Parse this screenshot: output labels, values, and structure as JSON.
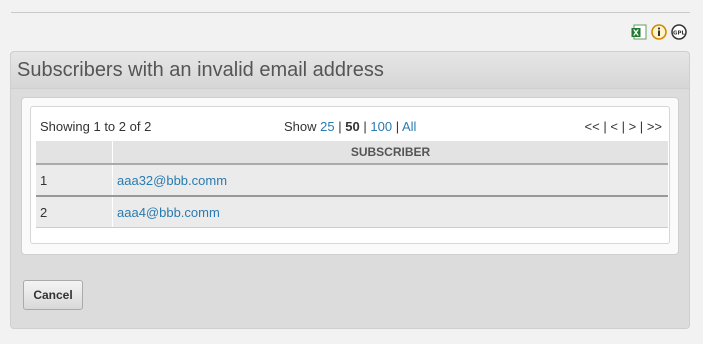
{
  "icons": [
    "excel-export-icon",
    "info-icon",
    "gpl-icon"
  ],
  "panel": {
    "title": "Subscribers with an invalid email address"
  },
  "pager": {
    "summary": "Showing 1 to 2 of 2",
    "show_label": "Show",
    "sizes": [
      "25",
      "50",
      "100",
      "All"
    ],
    "current_size": "50",
    "nav": [
      "<<",
      "<",
      ">",
      ">>"
    ]
  },
  "table": {
    "headers": [
      "",
      "SUBSCRIBER"
    ],
    "rows": [
      {
        "num": "1",
        "email": "aaa32@bbb.comm"
      },
      {
        "num": "2",
        "email": "aaa4@bbb.comm"
      }
    ]
  },
  "buttons": {
    "cancel": "Cancel"
  },
  "colors": {
    "link": "#2a7bb0",
    "panel_bg": "#dcdcdc"
  }
}
